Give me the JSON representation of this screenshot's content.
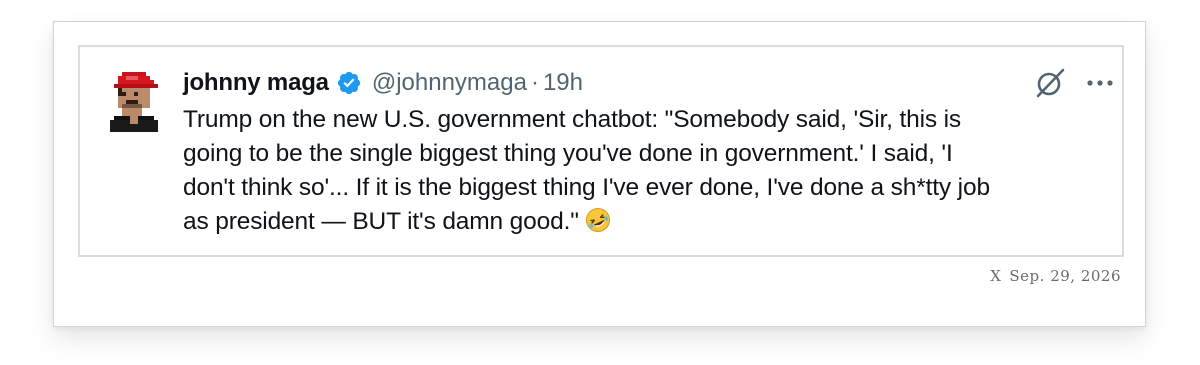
{
  "tweet": {
    "display_name": "johnny maga",
    "handle": "@johnnymaga",
    "separator": "·",
    "time": "19h",
    "text_lines": [
      "Trump on the new U.S. government chatbot: \"Somebody said, 'Sir, this is",
      "going to be the single biggest thing you've done in government.' I said, 'I",
      "don't think so'... If it is the biggest thing I've ever done, I've done a sh*tty job",
      "as president — BUT it's damn good.\""
    ],
    "emoji": "rolling-on-the-floor-laughing",
    "verified_color": "#1d9bf0"
  },
  "footer": {
    "source": "X",
    "date": "Sep. 29, 2026"
  },
  "icons": {
    "avatar": "pixel-avatar-red-cap",
    "verified": "verified-badge-icon",
    "grok": "grok-icon",
    "more": "more-icon"
  }
}
